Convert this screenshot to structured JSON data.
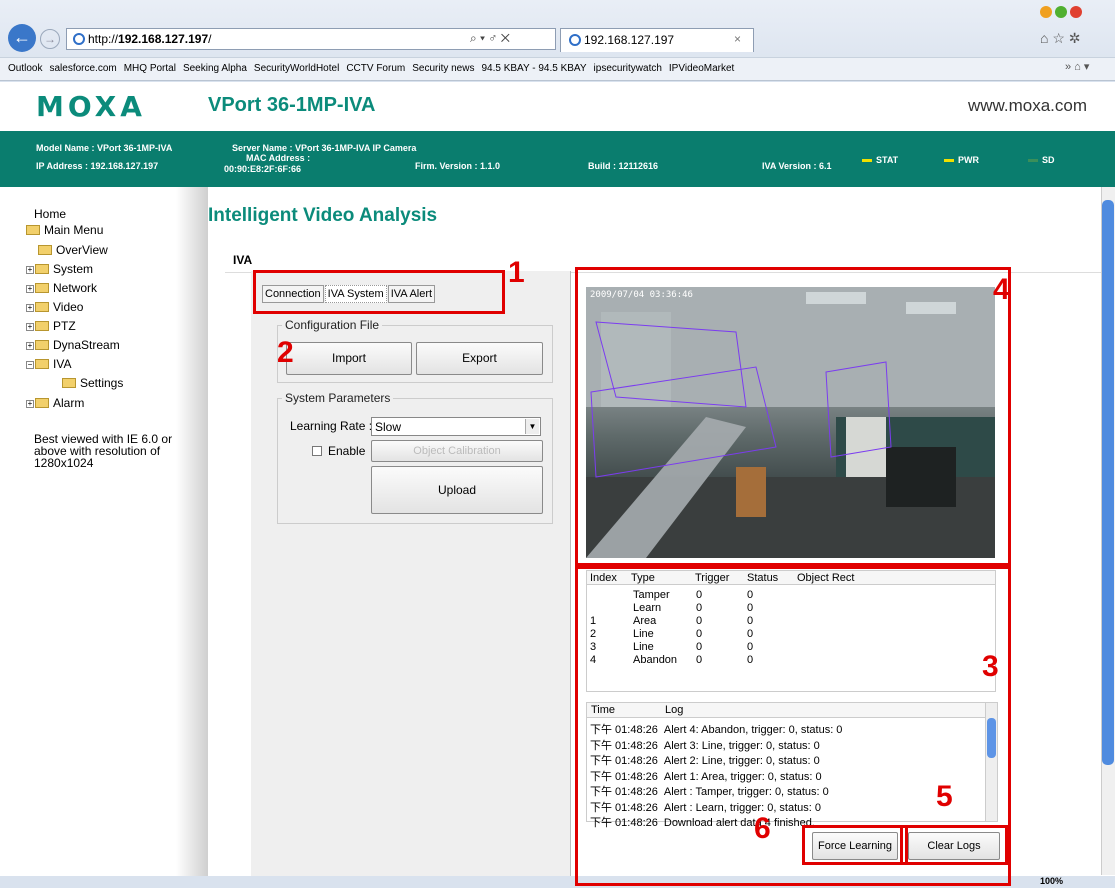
{
  "browser": {
    "url_prefix": "http://",
    "url_host": "192.168.127.197",
    "url_suffix": "/",
    "addr_tools": "⌕ ▾ ♂ ✕",
    "tab_title": "192.168.127.197",
    "tab_close": "×",
    "tools_icons": "⌂ ☆ ✲",
    "back_glyph": "←",
    "fwd_glyph": "→",
    "favorites": [
      "Outlook",
      "salesforce.com",
      "MHQ Portal",
      "Seeking Alpha",
      "SecurityWorldHotel",
      "CCTV Forum",
      "Security news",
      "94.5 KBAY - 94.5 KBAY",
      "ipsecuritywatch",
      "IPVideoMarket"
    ],
    "fav_end": "» ⌂ ▾",
    "zoom": "100%"
  },
  "header": {
    "logo": "MOXA",
    "product": "VPort 36-1MP-IVA",
    "site": "www.moxa.com"
  },
  "info": {
    "model": "Model Name : VPort 36-1MP-IVA",
    "ip": "IP Address : 192.168.127.197",
    "server": "Server Name : VPort 36-1MP-IVA IP Camera",
    "mac_label": "MAC Address :",
    "mac": "00:90:E8:2F:6F:66",
    "firm": "Firm. Version : 1.1.0",
    "build": "Build : 12112616",
    "iva": "IVA Version : 6.1",
    "stat": "STAT",
    "pwr": "PWR",
    "sd": "SD",
    "colors": {
      "stat": "#f0e000",
      "pwr": "#f0e000",
      "sd": "#3a8f5a"
    }
  },
  "nav": {
    "home": "Home",
    "main_menu": "Main Menu",
    "items": [
      "OverView",
      "System",
      "Network",
      "Video",
      "PTZ",
      "DynaStream",
      "IVA",
      "Settings",
      "Alarm"
    ],
    "note": "Best viewed with IE 6.0 or above with resolution of 1280x1024"
  },
  "page": {
    "title": "Intelligent Video Analysis",
    "section_tab": "IVA",
    "tabs": [
      "Connection",
      "IVA System",
      "IVA Alert"
    ],
    "config_group": "Configuration File",
    "import": "Import",
    "export": "Export",
    "params_group": "System Parameters",
    "learning_rate_label": "Learning Rate :",
    "learning_rate_value": "Slow",
    "enable_label": "Enable",
    "object_calibration": "Object Calibration",
    "upload": "Upload",
    "video_timestamp": "2009/07/04 03:36:46"
  },
  "objects": {
    "headers": [
      "Index",
      "Type",
      "Trigger",
      "Status",
      "Object Rect"
    ],
    "rows": [
      {
        "index": "",
        "type": "Tamper",
        "trigger": "0",
        "status": "0"
      },
      {
        "index": "",
        "type": "Learn",
        "trigger": "0",
        "status": "0"
      },
      {
        "index": "1",
        "type": "Area",
        "trigger": "0",
        "status": "0"
      },
      {
        "index": "2",
        "type": "Line",
        "trigger": "0",
        "status": "0"
      },
      {
        "index": "3",
        "type": "Line",
        "trigger": "0",
        "status": "0"
      },
      {
        "index": "4",
        "type": "Abandon",
        "trigger": "0",
        "status": "0"
      }
    ]
  },
  "log": {
    "headers": [
      "Time",
      "Log"
    ],
    "rows": [
      {
        "time": "下午 01:48:26",
        "msg": "Alert 4: Abandon, trigger: 0, status: 0"
      },
      {
        "time": "下午 01:48:26",
        "msg": "Alert 3: Line, trigger: 0, status: 0"
      },
      {
        "time": "下午 01:48:26",
        "msg": "Alert 2: Line, trigger: 0, status: 0"
      },
      {
        "time": "下午 01:48:26",
        "msg": "Alert 1: Area, trigger: 0, status: 0"
      },
      {
        "time": "下午 01:48:26",
        "msg": "Alert : Tamper, trigger: 0, status: 0"
      },
      {
        "time": "下午 01:48:26",
        "msg": "Alert : Learn, trigger: 0, status: 0"
      },
      {
        "time": "下午 01:48:26",
        "msg": "Download alert data 4 finished."
      }
    ],
    "force_learning": "Force Learning",
    "clear_logs": "Clear Logs"
  },
  "annotations": [
    "1",
    "2",
    "3",
    "4",
    "5",
    "6"
  ]
}
